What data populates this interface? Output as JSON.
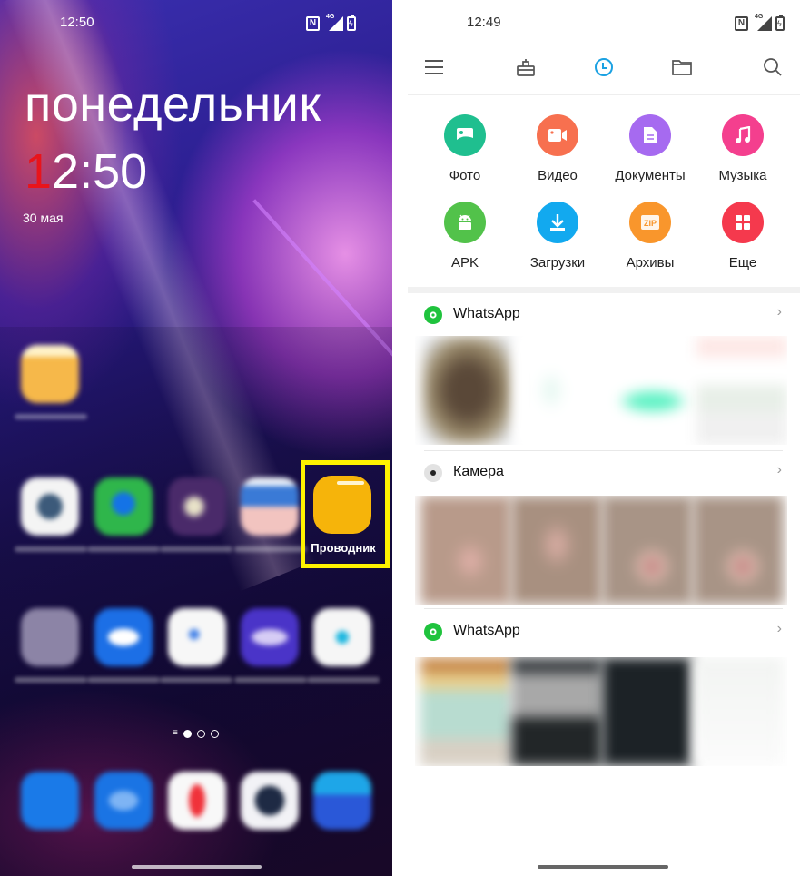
{
  "left_screen": {
    "status_bar": {
      "time": "12:50",
      "icons": [
        "nfc-icon",
        "mobile-data-icon",
        "signal-icon",
        "battery-charging-icon"
      ],
      "network_label": "4G"
    },
    "lock_widget": {
      "weekday": "понедельник",
      "clock_first_digit": "1",
      "clock_rest": "2:50",
      "date": "30 мая",
      "accent_color": "#e8141b"
    },
    "highlighted_app": {
      "label": "Проводник",
      "icon": "folder-icon",
      "icon_color": "#f6b40a",
      "highlight_color": "#fff200"
    },
    "pager": {
      "pages": 3,
      "current_page": 1
    }
  },
  "right_screen": {
    "status_bar": {
      "time": "12:49",
      "network_label": "4G"
    },
    "toolbar": {
      "items": [
        {
          "name": "menu",
          "icon": "hamburger-menu-icon",
          "active": false
        },
        {
          "name": "cleaner",
          "icon": "brush-icon",
          "active": false
        },
        {
          "name": "recent",
          "icon": "clock-icon",
          "active": true
        },
        {
          "name": "files",
          "icon": "folder-icon",
          "active": false
        },
        {
          "name": "search",
          "icon": "search-icon",
          "active": false
        }
      ],
      "active_color": "#1ba1e2"
    },
    "categories": [
      {
        "label": "Фото",
        "icon": "image-icon",
        "color": "#1fbf8f"
      },
      {
        "label": "Видео",
        "icon": "video-camera-icon",
        "color": "#f7704f"
      },
      {
        "label": "Документы",
        "icon": "document-icon",
        "color": "#a66af0"
      },
      {
        "label": "Музыка",
        "icon": "music-note-icon",
        "color": "#f43f8e"
      },
      {
        "label": "APK",
        "icon": "android-icon",
        "color": "#52c24a"
      },
      {
        "label": "Загрузки",
        "icon": "download-icon",
        "color": "#12a9ef"
      },
      {
        "label": "Архивы",
        "icon": "zip-icon",
        "color": "#f9962c"
      },
      {
        "label": "Еще",
        "icon": "grid-icon",
        "color": "#f5394d"
      }
    ],
    "recent_groups": [
      {
        "name": "WhatsApp",
        "icon": "whatsapp-icon",
        "icon_color": "#1fc33d"
      },
      {
        "name": "Камера",
        "icon": "camera-dot-icon",
        "icon_color": "#e2e2e2"
      },
      {
        "name": "WhatsApp",
        "icon": "whatsapp-icon",
        "icon_color": "#1fc33d"
      }
    ],
    "chevron": "›"
  }
}
